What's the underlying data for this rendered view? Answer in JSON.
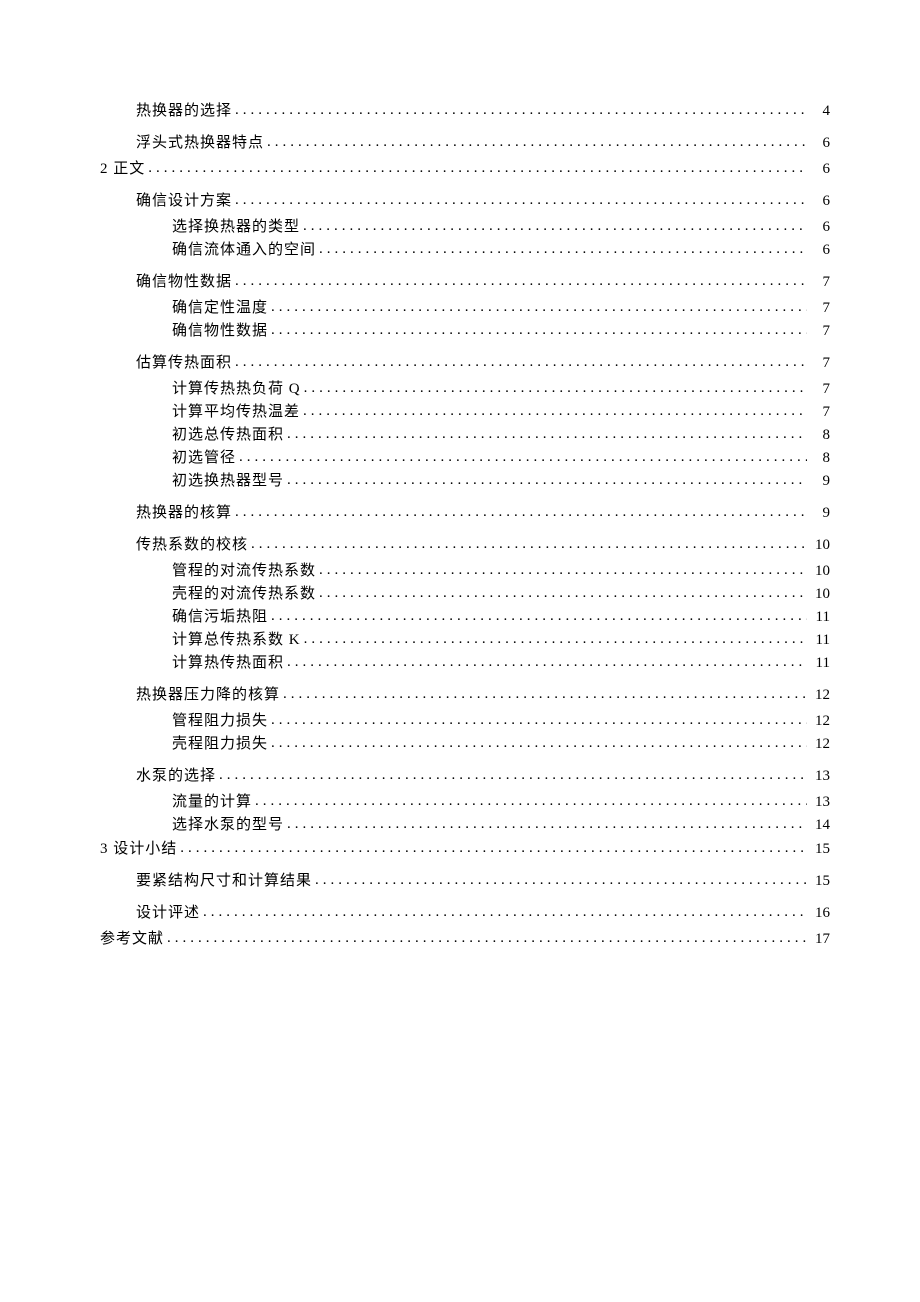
{
  "toc": [
    {
      "label": "热换器的选择",
      "page": "4",
      "level": 1
    },
    {
      "label": "浮头式热换器特点",
      "page": "6",
      "level": 1
    },
    {
      "label": "2 正文",
      "page": "6",
      "level": 0
    },
    {
      "label": "确信设计方案",
      "page": "6",
      "level": 1
    },
    {
      "label": "选择换热器的类型",
      "page": "6",
      "level": 2
    },
    {
      "label": "确信流体通入的空间",
      "page": "6",
      "level": 2
    },
    {
      "label": "确信物性数据",
      "page": "7",
      "level": 1
    },
    {
      "label": "确信定性温度",
      "page": "7",
      "level": 2
    },
    {
      "label": "确信物性数据",
      "page": "7",
      "level": 2
    },
    {
      "label": "估算传热面积",
      "page": "7",
      "level": 1
    },
    {
      "label": "计算传热热负荷 Q",
      "page": "7",
      "level": 2
    },
    {
      "label": "计算平均传热温差",
      "page": "7",
      "level": 2
    },
    {
      "label": "初选总传热面积",
      "page": "8",
      "level": 2
    },
    {
      "label": "初选管径",
      "page": "8",
      "level": 2
    },
    {
      "label": "初选换热器型号",
      "page": "9",
      "level": 2
    },
    {
      "label": "热换器的核算",
      "page": "9",
      "level": 1
    },
    {
      "label": "传热系数的校核",
      "page": "10",
      "level": 1
    },
    {
      "label": "管程的对流传热系数",
      "page": "10",
      "level": 2
    },
    {
      "label": "壳程的对流传热系数",
      "page": "10",
      "level": 2
    },
    {
      "label": "确信污垢热阻",
      "page": "11",
      "level": 2
    },
    {
      "label": "计算总传热系数 K",
      "page": "11",
      "level": 2
    },
    {
      "label": "计算热传热面积",
      "page": "11",
      "level": 2
    },
    {
      "label": "热换器压力降的核算",
      "page": "12",
      "level": 1
    },
    {
      "label": "管程阻力损失",
      "page": "12",
      "level": 2
    },
    {
      "label": "壳程阻力损失",
      "page": "12",
      "level": 2
    },
    {
      "label": "水泵的选择",
      "page": "13",
      "level": 1
    },
    {
      "label": "流量的计算",
      "page": "13",
      "level": 2
    },
    {
      "label": "选择水泵的型号",
      "page": "14",
      "level": 2
    },
    {
      "label": "3 设计小结",
      "page": "15",
      "level": 0
    },
    {
      "label": "要紧结构尺寸和计算结果",
      "page": "15",
      "level": 1
    },
    {
      "label": "设计评述",
      "page": "16",
      "level": 1
    },
    {
      "label": "参考文献",
      "page": "17",
      "level": 0
    }
  ]
}
